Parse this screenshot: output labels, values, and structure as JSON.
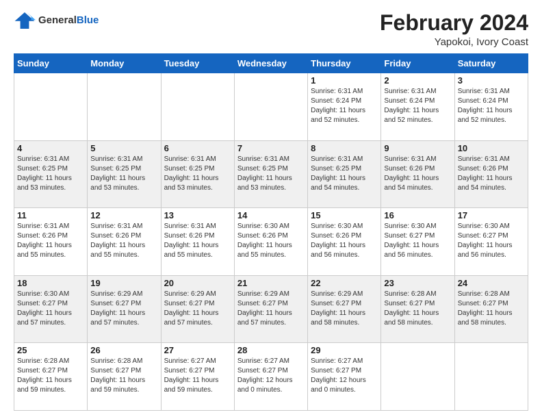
{
  "logo": {
    "general": "General",
    "blue": "Blue"
  },
  "header": {
    "month": "February 2024",
    "location": "Yapokoi, Ivory Coast"
  },
  "weekdays": [
    "Sunday",
    "Monday",
    "Tuesday",
    "Wednesday",
    "Thursday",
    "Friday",
    "Saturday"
  ],
  "weeks": [
    [
      {
        "day": "",
        "info": ""
      },
      {
        "day": "",
        "info": ""
      },
      {
        "day": "",
        "info": ""
      },
      {
        "day": "",
        "info": ""
      },
      {
        "day": "1",
        "info": "Sunrise: 6:31 AM\nSunset: 6:24 PM\nDaylight: 11 hours\nand 52 minutes."
      },
      {
        "day": "2",
        "info": "Sunrise: 6:31 AM\nSunset: 6:24 PM\nDaylight: 11 hours\nand 52 minutes."
      },
      {
        "day": "3",
        "info": "Sunrise: 6:31 AM\nSunset: 6:24 PM\nDaylight: 11 hours\nand 52 minutes."
      }
    ],
    [
      {
        "day": "4",
        "info": "Sunrise: 6:31 AM\nSunset: 6:25 PM\nDaylight: 11 hours\nand 53 minutes."
      },
      {
        "day": "5",
        "info": "Sunrise: 6:31 AM\nSunset: 6:25 PM\nDaylight: 11 hours\nand 53 minutes."
      },
      {
        "day": "6",
        "info": "Sunrise: 6:31 AM\nSunset: 6:25 PM\nDaylight: 11 hours\nand 53 minutes."
      },
      {
        "day": "7",
        "info": "Sunrise: 6:31 AM\nSunset: 6:25 PM\nDaylight: 11 hours\nand 53 minutes."
      },
      {
        "day": "8",
        "info": "Sunrise: 6:31 AM\nSunset: 6:25 PM\nDaylight: 11 hours\nand 54 minutes."
      },
      {
        "day": "9",
        "info": "Sunrise: 6:31 AM\nSunset: 6:26 PM\nDaylight: 11 hours\nand 54 minutes."
      },
      {
        "day": "10",
        "info": "Sunrise: 6:31 AM\nSunset: 6:26 PM\nDaylight: 11 hours\nand 54 minutes."
      }
    ],
    [
      {
        "day": "11",
        "info": "Sunrise: 6:31 AM\nSunset: 6:26 PM\nDaylight: 11 hours\nand 55 minutes."
      },
      {
        "day": "12",
        "info": "Sunrise: 6:31 AM\nSunset: 6:26 PM\nDaylight: 11 hours\nand 55 minutes."
      },
      {
        "day": "13",
        "info": "Sunrise: 6:31 AM\nSunset: 6:26 PM\nDaylight: 11 hours\nand 55 minutes."
      },
      {
        "day": "14",
        "info": "Sunrise: 6:30 AM\nSunset: 6:26 PM\nDaylight: 11 hours\nand 55 minutes."
      },
      {
        "day": "15",
        "info": "Sunrise: 6:30 AM\nSunset: 6:26 PM\nDaylight: 11 hours\nand 56 minutes."
      },
      {
        "day": "16",
        "info": "Sunrise: 6:30 AM\nSunset: 6:27 PM\nDaylight: 11 hours\nand 56 minutes."
      },
      {
        "day": "17",
        "info": "Sunrise: 6:30 AM\nSunset: 6:27 PM\nDaylight: 11 hours\nand 56 minutes."
      }
    ],
    [
      {
        "day": "18",
        "info": "Sunrise: 6:30 AM\nSunset: 6:27 PM\nDaylight: 11 hours\nand 57 minutes."
      },
      {
        "day": "19",
        "info": "Sunrise: 6:29 AM\nSunset: 6:27 PM\nDaylight: 11 hours\nand 57 minutes."
      },
      {
        "day": "20",
        "info": "Sunrise: 6:29 AM\nSunset: 6:27 PM\nDaylight: 11 hours\nand 57 minutes."
      },
      {
        "day": "21",
        "info": "Sunrise: 6:29 AM\nSunset: 6:27 PM\nDaylight: 11 hours\nand 57 minutes."
      },
      {
        "day": "22",
        "info": "Sunrise: 6:29 AM\nSunset: 6:27 PM\nDaylight: 11 hours\nand 58 minutes."
      },
      {
        "day": "23",
        "info": "Sunrise: 6:28 AM\nSunset: 6:27 PM\nDaylight: 11 hours\nand 58 minutes."
      },
      {
        "day": "24",
        "info": "Sunrise: 6:28 AM\nSunset: 6:27 PM\nDaylight: 11 hours\nand 58 minutes."
      }
    ],
    [
      {
        "day": "25",
        "info": "Sunrise: 6:28 AM\nSunset: 6:27 PM\nDaylight: 11 hours\nand 59 minutes."
      },
      {
        "day": "26",
        "info": "Sunrise: 6:28 AM\nSunset: 6:27 PM\nDaylight: 11 hours\nand 59 minutes."
      },
      {
        "day": "27",
        "info": "Sunrise: 6:27 AM\nSunset: 6:27 PM\nDaylight: 11 hours\nand 59 minutes."
      },
      {
        "day": "28",
        "info": "Sunrise: 6:27 AM\nSunset: 6:27 PM\nDaylight: 12 hours\nand 0 minutes."
      },
      {
        "day": "29",
        "info": "Sunrise: 6:27 AM\nSunset: 6:27 PM\nDaylight: 12 hours\nand 0 minutes."
      },
      {
        "day": "",
        "info": ""
      },
      {
        "day": "",
        "info": ""
      }
    ]
  ]
}
